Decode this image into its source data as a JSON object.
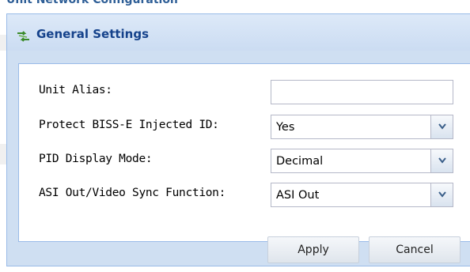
{
  "background": {
    "partial_title": "Unit Network Configuration"
  },
  "dialog": {
    "title": "General Settings",
    "icon": "settings-arrows-icon"
  },
  "form": {
    "fields": [
      {
        "label": "Unit Alias:",
        "type": "text",
        "value": ""
      },
      {
        "label": "Protect BISS-E Injected ID:",
        "type": "select",
        "value": "Yes"
      },
      {
        "label": "PID Display Mode:",
        "type": "select",
        "value": "Decimal"
      },
      {
        "label": "ASI Out/Video Sync Function:",
        "type": "select",
        "value": "ASI Out"
      }
    ]
  },
  "buttons": {
    "apply": "Apply",
    "cancel": "Cancel"
  },
  "colors": {
    "header_bg": "#cfdff2",
    "title_text": "#15428b",
    "border": "#99bbe8"
  }
}
